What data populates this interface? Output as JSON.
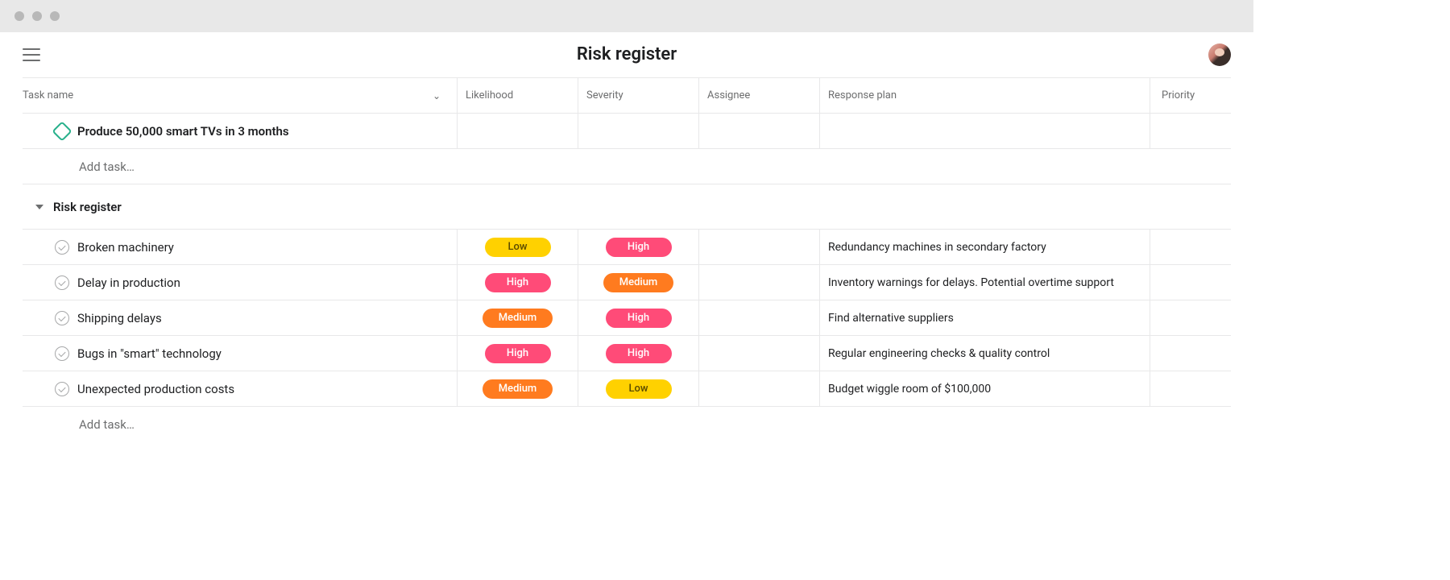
{
  "header": {
    "title": "Risk register"
  },
  "columns": {
    "task": "Task name",
    "likelihood": "Likelihood",
    "severity": "Severity",
    "assignee": "Assignee",
    "response": "Response plan",
    "priority": "Priority"
  },
  "goal": {
    "name": "Produce 50,000 smart TVs in 3 months"
  },
  "add_task_label": "Add task…",
  "section": {
    "name": "Risk register"
  },
  "tasks": [
    {
      "name": "Broken machinery",
      "likelihood": "Low",
      "severity": "High",
      "response": "Redundancy machines in secondary factory"
    },
    {
      "name": "Delay in production",
      "likelihood": "High",
      "severity": "Medium",
      "response": "Inventory warnings for delays. Potential overtime support"
    },
    {
      "name": "Shipping delays",
      "likelihood": "Medium",
      "severity": "High",
      "response": "Find alternative suppliers"
    },
    {
      "name": "Bugs in \"smart\" technology",
      "likelihood": "High",
      "severity": "High",
      "response": "Regular engineering checks & quality control"
    },
    {
      "name": "Unexpected production costs",
      "likelihood": "Medium",
      "severity": "Low",
      "response": "Budget wiggle room of $100,000"
    }
  ],
  "tag_colors": {
    "Low": "tag-low",
    "Medium": "tag-medium",
    "High": "tag-high"
  }
}
